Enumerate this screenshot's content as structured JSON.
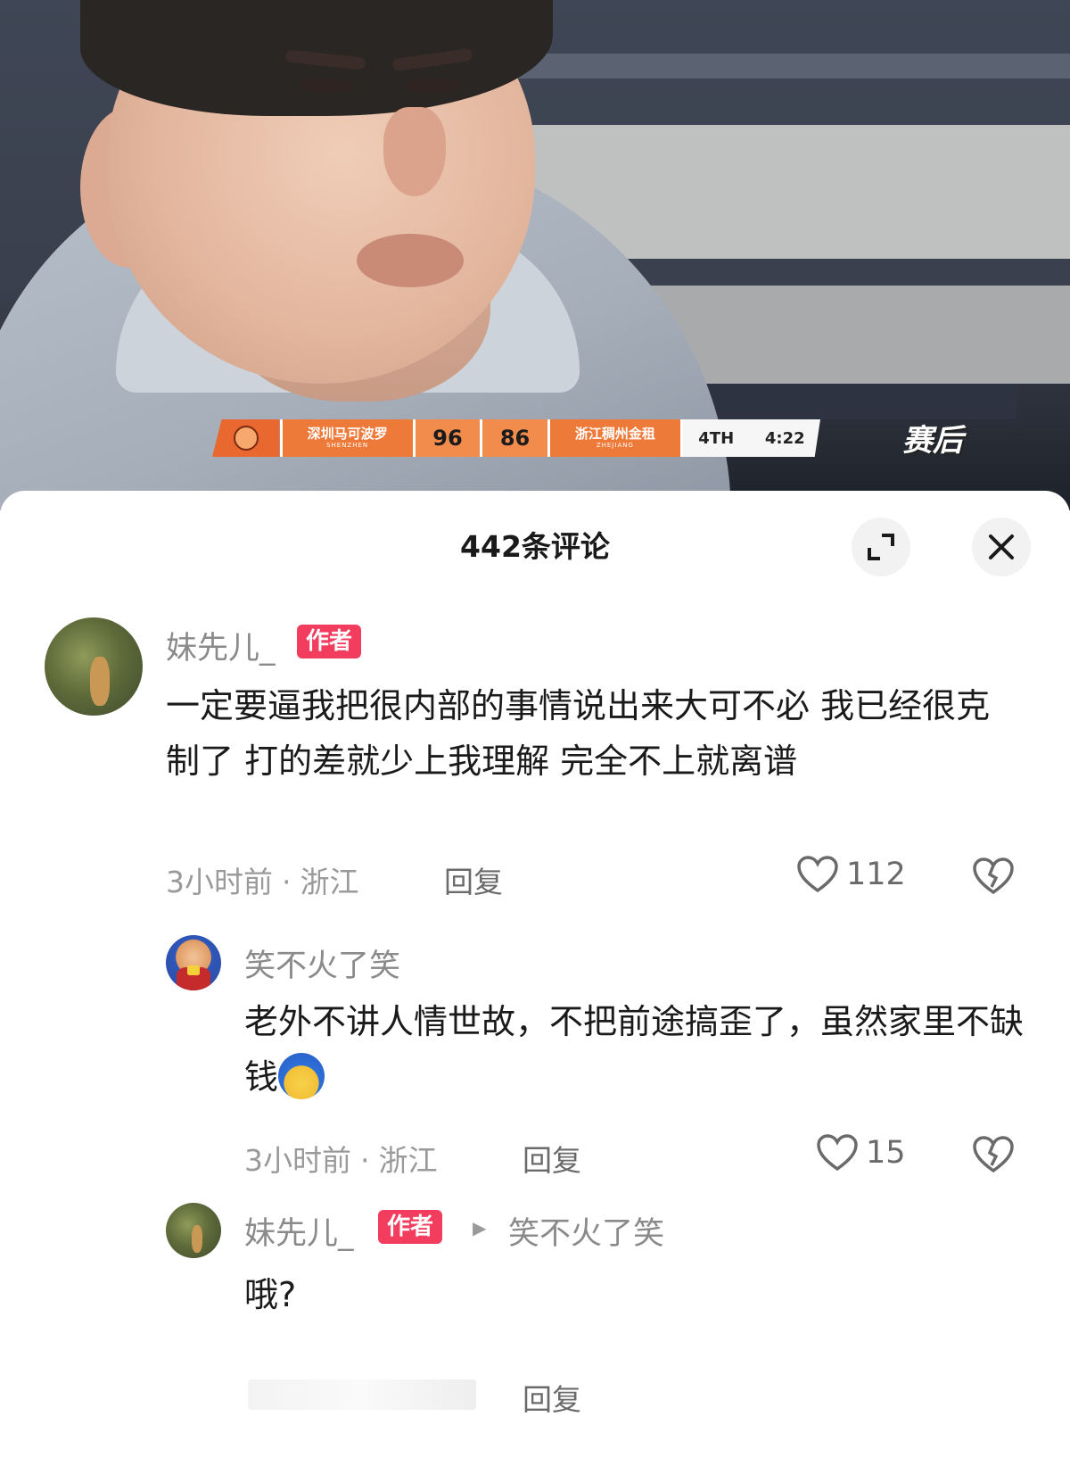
{
  "video": {
    "scoreboard": {
      "home_name": "深圳马可波罗",
      "home_sub": "SHENZHEN",
      "home_score": "96",
      "away_score": "86",
      "away_name": "浙江稠州金租",
      "away_sub": "ZHEJIANG",
      "period": "4TH",
      "clock": "4:22"
    },
    "channel_logo": "赛后"
  },
  "sheet": {
    "title": "442条评论",
    "expand_icon": "expand-icon",
    "close_icon": "close-icon"
  },
  "comments": [
    {
      "username": "妹先儿_",
      "badge": "作者",
      "text": "一定要逼我把很内部的事情说出来大可不必 我已经很克制了 打的差就少上我理解  完全不上就离谱",
      "time": "3小时前",
      "location": "浙江",
      "reply_label": "回复",
      "likes": "112"
    },
    {
      "username": "笑不火了笑",
      "text": "老外不讲人情世故，不把前途搞歪了，虽然家里不缺钱",
      "time": "3小时前",
      "location": "浙江",
      "reply_label": "回复",
      "likes": "15"
    },
    {
      "username": "妹先儿_",
      "badge": "作者",
      "reply_to": "笑不火了笑",
      "text": "哦?",
      "reply_label": "回复"
    }
  ],
  "colors": {
    "badge": "#f23d5e",
    "scoreboard_orange": "#ee7a3a"
  }
}
